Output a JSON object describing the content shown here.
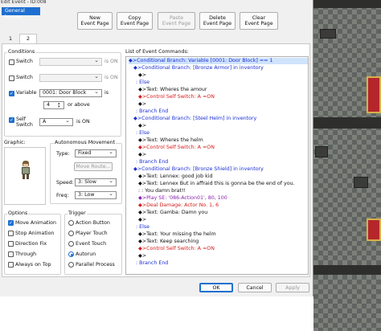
{
  "window": {
    "title": "Edit Event - ID:008"
  },
  "name_field": {
    "value": "General lennex"
  },
  "toolbar": {
    "new_page": "New\nEvent Page",
    "copy_page": "Copy\nEvent Page",
    "paste_page": "Paste\nEvent Page",
    "delete_page": "Delete\nEvent Page",
    "clear_page": "Clear\nEvent Page"
  },
  "tabs": [
    "1",
    "2"
  ],
  "conditions": {
    "legend": "Conditions",
    "switch1_label": "Switch",
    "switch1_suffix": "is ON",
    "switch2_label": "Switch",
    "switch2_suffix": "is ON",
    "variable_label": "Variable",
    "variable_value": "0001: Door Block",
    "variable_is": "is",
    "variable_number": "4",
    "variable_or_above": "or above",
    "self_switch_label": "Self\nSwitch",
    "self_switch_value": "A",
    "self_switch_suffix": "is ON"
  },
  "graphic": {
    "legend": "Graphic:"
  },
  "autonomous": {
    "legend": "Autonomous Movement",
    "type_label": "Type:",
    "type_value": "Fixed",
    "move_route": "Move Route...",
    "speed_label": "Speed:",
    "speed_value": "3: Slow",
    "freq_label": "Freq:",
    "freq_value": "3: Low"
  },
  "options": {
    "legend": "Options",
    "move_animation": "Move Animation",
    "stop_animation": "Stop Animation",
    "direction_fix": "Direction Fix",
    "through": "Through",
    "always_on_top": "Always on Top"
  },
  "trigger": {
    "legend": "Trigger",
    "action_button": "Action Button",
    "player_touch": "Player Touch",
    "event_touch": "Event Touch",
    "autorun": "Autorun",
    "parallel_process": "Parallel Process"
  },
  "commands": {
    "legend": "List of Event Commands:",
    "lines": [
      "◆>Conditional Branch: Variable [0001: Door Block] == 1",
      "◆>Conditional Branch: [Bronze Armor] in inventory",
      "◆>",
      ": Else",
      "◆>Text: Wheres the amour",
      "◆>Control Self Switch: A =ON",
      "◆>",
      ": Branch End",
      "◆>Conditional Branch: [Steel Helm] in inventory",
      "◆>",
      ": Else",
      "◆>Text: Wheres the helm",
      "◆>Control Self Switch: A =ON",
      "◆>",
      ": Branch End",
      "◆>Conditional Branch: [Bronze Shield] in inventory",
      "◆>Text: Lennex: good job kid",
      "◆>Text: Lennex But in affraid this is gonna be the end of you.",
      ":               : You damn brat!!",
      "◆>Play SE: '086-Action01', 80, 100",
      "◆>Deal Damage: Actor No. 1, 6",
      "◆>Text: Gamba: Damn you",
      "◆>",
      ": Else",
      "◆>Text: Your missing the helm",
      "◆>Text: Keep searching",
      "◆>Control Self Switch: A =ON",
      "◆>",
      ": Branch End"
    ]
  },
  "footer": {
    "ok": "OK",
    "cancel": "Cancel",
    "apply": "Apply"
  },
  "colors": {
    "accent": "#1e6fd0",
    "branch": "#1a2fd6",
    "switch": "#d61a1a",
    "effect": "#8a1fb0",
    "carpet": "#b5262b"
  }
}
